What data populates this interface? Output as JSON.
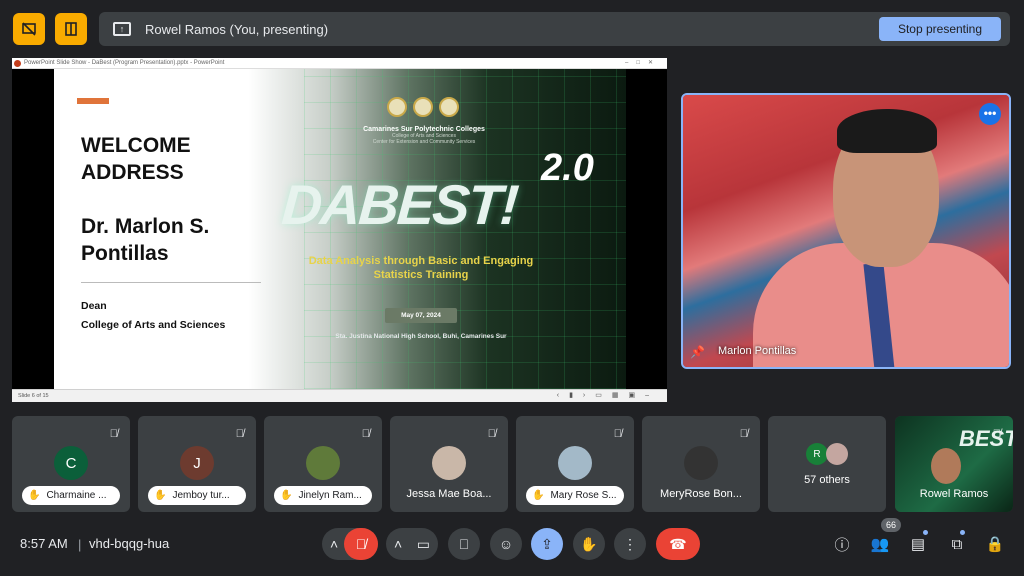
{
  "topbar": {
    "presenting_label": "Rowel Ramos (You, presenting)",
    "stop_label": "Stop presenting"
  },
  "ppt": {
    "window_title": "PowerPoint Slide Show - DaBest (Program Presentation).pptx - PowerPoint",
    "status": "Slide 6 of 15"
  },
  "slide": {
    "welcome": "WELCOME ADDRESS",
    "speaker": "Dr. Marlon S. Pontillas",
    "role": "Dean",
    "dept": "College of Arts and Sciences",
    "institution": "Camarines Sur Polytechnic Colleges",
    "college": "College of Arts and Sciences",
    "center": "Center for Extension and Community Services",
    "event": "DABEST",
    "event_version": "2.0",
    "event_mark": "!",
    "tagline": "Data Analysis through Basic and Engaging Statistics Training",
    "date": "May 07, 2024",
    "venue": "Sta. Justina National High School, Buhi, Camarines Sur"
  },
  "speaker_tile": {
    "name": "Marlon Pontillas",
    "more": "•••"
  },
  "participants": [
    {
      "name": "Charmaine ...",
      "initial": "C",
      "color": "#0b5f3a"
    },
    {
      "name": "Jemboy tur...",
      "initial": "J",
      "color": "#6d3b2f"
    },
    {
      "name": "Jinelyn Ram...",
      "initial": "",
      "color": "#5f7a3a"
    },
    {
      "name": "Jessa Mae Boa...",
      "initial": "",
      "color": "#c9b7a8"
    },
    {
      "name": "Mary Rose S...",
      "initial": "",
      "color": "#a3b9c8"
    },
    {
      "name": "MeryRose Bon...",
      "initial": "",
      "color": "#333333"
    }
  ],
  "others": {
    "label": "57 others",
    "initial": "R"
  },
  "self_tile": {
    "name": "Rowel Ramos",
    "thumb_text": "BEST"
  },
  "bottom": {
    "time": "8:57 AM",
    "separator": "|",
    "meeting_code": "vhd-bqqg-hua",
    "people_count": "66"
  }
}
